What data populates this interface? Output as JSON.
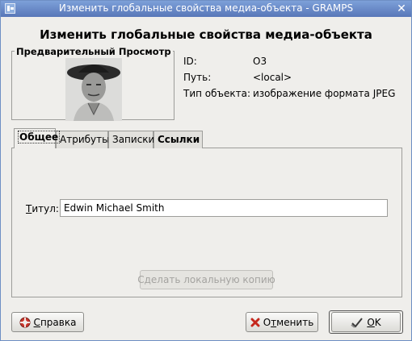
{
  "window": {
    "title": "Изменить глобальные свойства медиа-объекта - GRAMPS",
    "close_glyph": "✕"
  },
  "heading": "Изменить глобальные свойства медиа-объекта",
  "preview": {
    "legend": "Предварительный Просмотр"
  },
  "info": {
    "id_label": "ID:",
    "id_value": "O3",
    "path_label": "Путь:",
    "path_value": "<local>",
    "type_label": "Тип объекта:",
    "type_value": "изображение формата JPEG"
  },
  "tabs": [
    {
      "label": "Общее",
      "active": true
    },
    {
      "label": "Атрибуты",
      "active": false
    },
    {
      "label": "Записки",
      "active": false
    },
    {
      "label": "Ссылки",
      "active": false
    }
  ],
  "general": {
    "title_label_mnemonic": "Т",
    "title_label_rest": "итул:",
    "title_value": "Edwin Michael Smith",
    "local_copy_button": "Сделать локальную копию"
  },
  "buttons": {
    "help_mnemonic": "С",
    "help_rest": "правка",
    "cancel_pre": "О",
    "cancel_mnemonic": "т",
    "cancel_rest": "менить",
    "ok_mnemonic": "O",
    "ok_rest": "K"
  },
  "icons": {
    "help": "help-lifebuoy-icon",
    "cancel": "cancel-x-icon",
    "ok": "ok-check-icon"
  }
}
